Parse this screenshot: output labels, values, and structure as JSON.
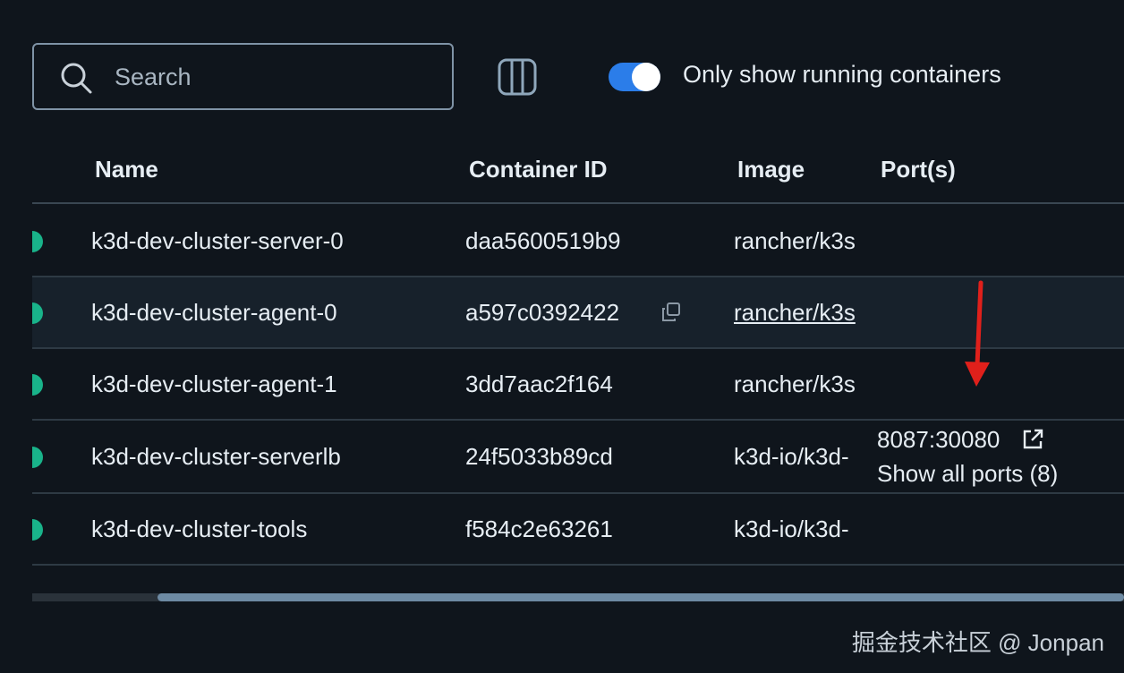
{
  "toolbar": {
    "search_placeholder": "Search",
    "columns_icon": "columns-icon",
    "toggle_on": true,
    "toggle_label": "Only show running containers",
    "accent_color": "#2b7de9"
  },
  "table": {
    "headers": {
      "name": "Name",
      "container_id": "Container ID",
      "image": "Image",
      "ports": "Port(s)"
    },
    "rows": [
      {
        "name": "k3d-dev-cluster-server-0",
        "id": "daa5600519b9",
        "image": "rancher/k3s",
        "status": "running"
      },
      {
        "name": "k3d-dev-cluster-agent-0",
        "id": "a597c0392422",
        "image": "rancher/k3s",
        "status": "running"
      },
      {
        "name": "k3d-dev-cluster-agent-1",
        "id": "3dd7aac2f164",
        "image": "rancher/k3s",
        "status": "running"
      },
      {
        "name": "k3d-dev-cluster-serverlb",
        "id": "24f5033b89cd",
        "image": "k3d-io/k3d-",
        "status": "running",
        "port": "8087:30080",
        "show_all": "Show all ports (8)"
      },
      {
        "name": "k3d-dev-cluster-tools",
        "id": "f584c2e63261",
        "image": "k3d-io/k3d-",
        "status": "running"
      }
    ],
    "status_color": "#19b38a"
  },
  "annotation": {
    "arrow_color": "#e0201b"
  },
  "watermark": "掘金技术社区 @ Jonpan"
}
